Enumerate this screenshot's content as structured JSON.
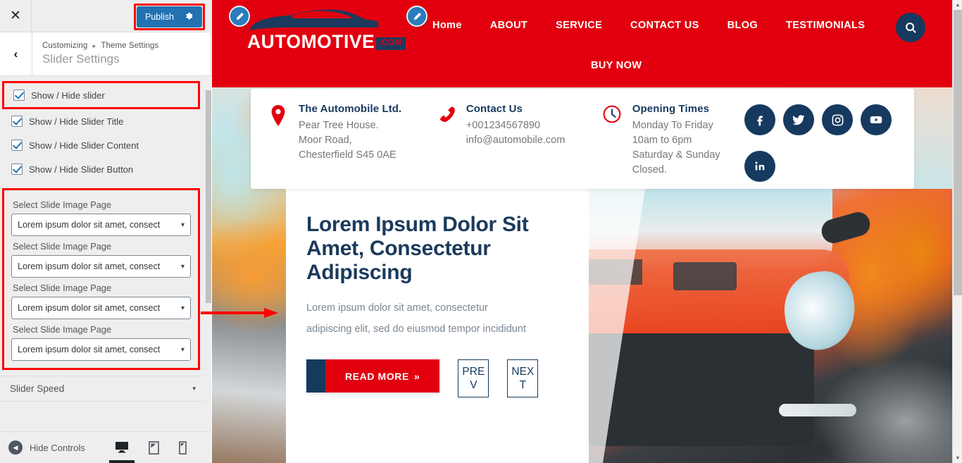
{
  "customizer": {
    "close_label": "✕",
    "publish_label": "Publish",
    "gear_icon": "gear-icon",
    "back_label": "‹",
    "breadcrumb_root": "Customizing",
    "breadcrumb_sep": "▸",
    "breadcrumb_parent": "Theme Settings",
    "panel_title": "Slider Settings",
    "checkboxes": [
      {
        "label": "Show / Hide slider",
        "checked": true,
        "highlighted": true
      },
      {
        "label": "Show / Hide Slider Title",
        "checked": true,
        "highlighted": false
      },
      {
        "label": "Show / Hide Slider Content",
        "checked": true,
        "highlighted": false
      },
      {
        "label": "Show / Hide Slider Button",
        "checked": true,
        "highlighted": false
      }
    ],
    "selects": [
      {
        "label": "Select Slide Image Page",
        "value": "Lorem ipsum dolor sit amet, consect"
      },
      {
        "label": "Select Slide Image Page",
        "value": "Lorem ipsum dolor sit amet, consect"
      },
      {
        "label": "Select Slide Image Page",
        "value": "Lorem ipsum dolor sit amet, consect"
      },
      {
        "label": "Select Slide Image Page",
        "value": "Lorem ipsum dolor sit amet, consect"
      }
    ],
    "slider_speed_label": "Slider Speed",
    "footer": {
      "hide_controls_label": "Hide Controls",
      "devices": [
        {
          "name": "desktop",
          "active": true
        },
        {
          "name": "tablet",
          "active": false
        },
        {
          "name": "mobile",
          "active": false
        }
      ]
    },
    "accent_blue": "#2271b1",
    "highlight_red": "#ff0000"
  },
  "site": {
    "logo": {
      "word": "AUTOMOTIVE",
      "suffix": ".COM"
    },
    "nav": {
      "row1": [
        "Home",
        "ABOUT",
        "SERVICE",
        "CONTACT US",
        "BLOG",
        "TESTIMONIALS"
      ],
      "row2": [
        "BUY NOW"
      ],
      "search_icon": "search-icon"
    },
    "brand_red": "#e2000f",
    "brand_navy": "#163a5f",
    "info_card": {
      "address": {
        "icon": "map-pin-icon",
        "title": "The Automobile Ltd.",
        "lines": [
          "Pear Tree House.",
          "Moor Road,",
          "Chesterfield S45 0AE"
        ]
      },
      "contact": {
        "icon": "phone-icon",
        "title": "Contact Us",
        "lines": [
          "+001234567890",
          "info@automobile.com"
        ]
      },
      "hours": {
        "icon": "clock-icon",
        "title": "Opening Times",
        "lines": [
          "Monday To Friday",
          "10am to 6pm",
          "Saturday & Sunday",
          "Closed."
        ]
      },
      "socials": [
        "facebook-icon",
        "twitter-icon",
        "instagram-icon",
        "youtube-icon",
        "linkedin-icon"
      ]
    },
    "slider": {
      "title": "Lorem Ipsum Dolor Sit Amet, Consectetur Adipiscing",
      "description": "Lorem ipsum dolor sit amet, consectetur adipiscing elit, sed do eiusmod tempor incididunt",
      "read_more_label": "READ MORE",
      "read_more_chevron": "»",
      "prev_label": "PREV",
      "next_label": "NEXT"
    }
  }
}
